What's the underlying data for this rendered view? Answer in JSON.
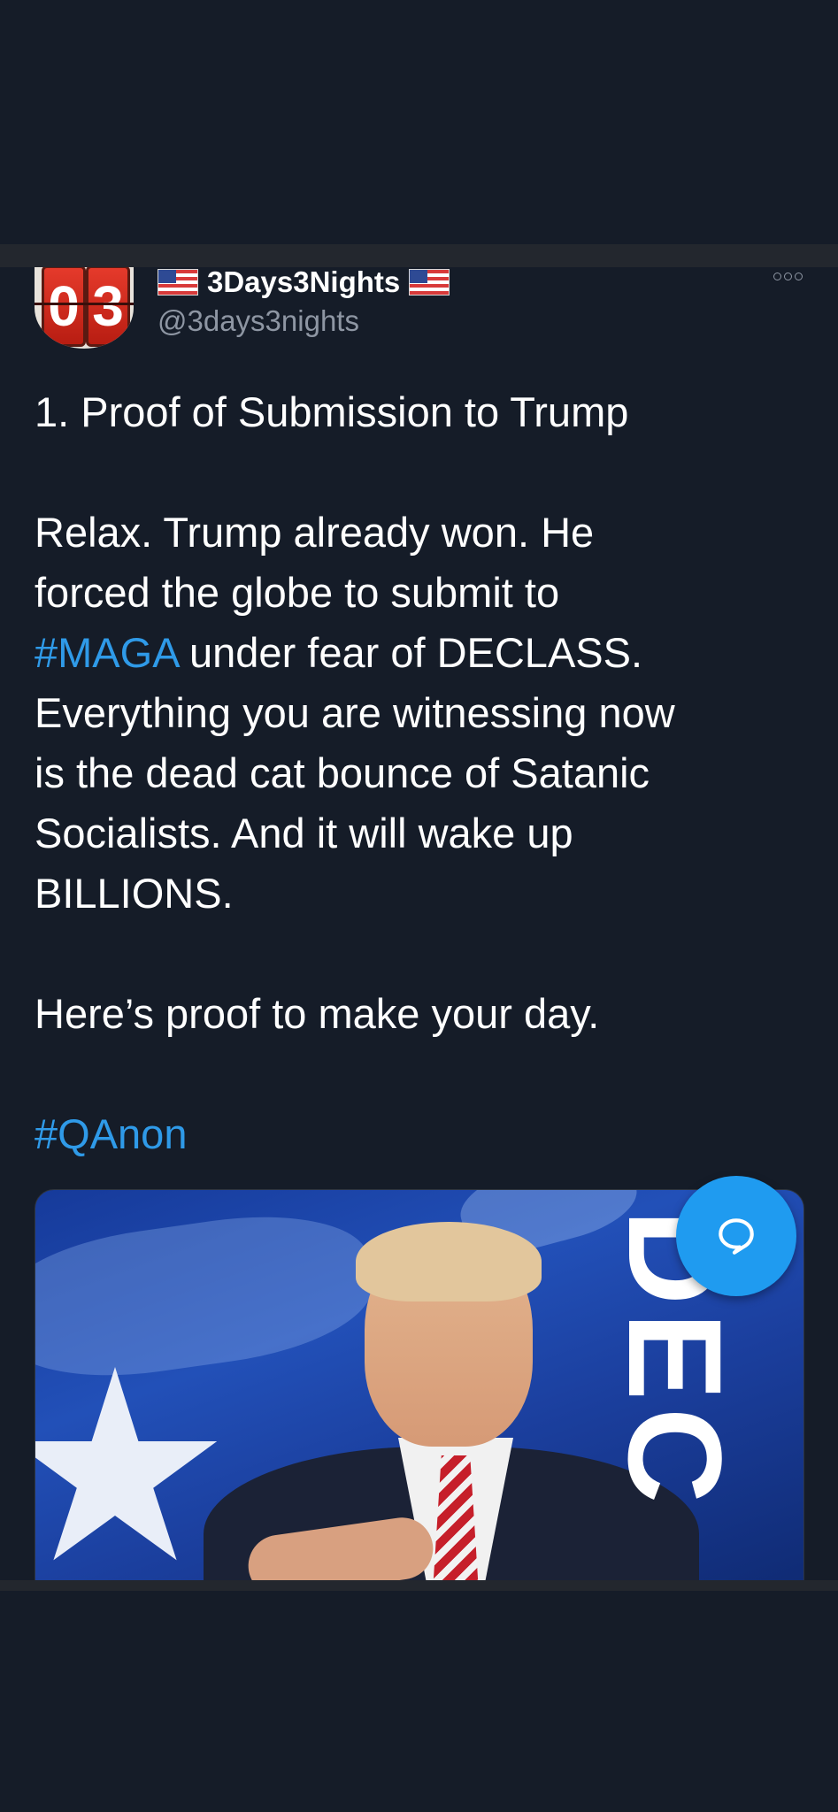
{
  "tweet": {
    "avatar_digits": [
      "0",
      "3"
    ],
    "display_name": "3Days3Nights",
    "handle": "@3days3nights",
    "paragraphs": [
      "1. Proof of Submission to Trump",
      "",
      "Relax. Trump already won. He",
      "forced the globe to submit to",
      "#MAGA| under fear of DECLASS.",
      "Everything you are witnessing now",
      "is the dead cat bounce of Satanic",
      "Socialists. And it will wake up",
      "BILLIONS.",
      "",
      "Here’s proof to make your day."
    ],
    "hashtag_maga": "#MAGA",
    "line_after_maga": " under fear of DECLASS.",
    "hashtag_qanon": "#QAnon",
    "media_letters": [
      "D",
      "E",
      "C"
    ]
  },
  "icons": {
    "more": "more-horizontal-icon",
    "compose": "compose-reply-icon",
    "flag": "us-flag-icon"
  },
  "colors": {
    "background": "#151c28",
    "accent": "#1f9bf0",
    "hashtag": "#2f9ae8",
    "secondary_text": "#8e96a3"
  }
}
